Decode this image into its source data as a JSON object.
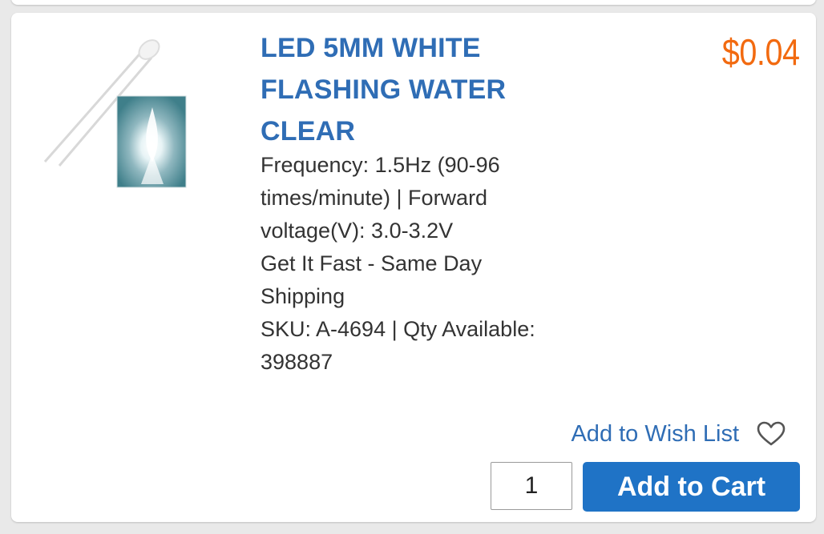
{
  "product": {
    "title": "LED 5MM WHITE FLASHING WATER CLEAR",
    "price": "$0.04",
    "image_alt": "LED 5mm white flashing product photo",
    "description_lines": [
      "Frequency: 1.5Hz (90-96",
      "times/minute) | Forward",
      "voltage(V): 3.0-3.2V",
      "Get It Fast - Same Day",
      "Shipping",
      "SKU: A-4694 | Qty Available:",
      "398887"
    ],
    "sku": "A-4694",
    "qty_available": "398887"
  },
  "actions": {
    "wishlist_label": "Add to Wish List",
    "wishlist_icon": "heart-outline-icon",
    "quantity_value": "1",
    "add_to_cart_label": "Add to Cart"
  },
  "colors": {
    "title": "#2f6db5",
    "price": "#f26a10",
    "button": "#1f73c6",
    "background": "#e9e9e9"
  }
}
